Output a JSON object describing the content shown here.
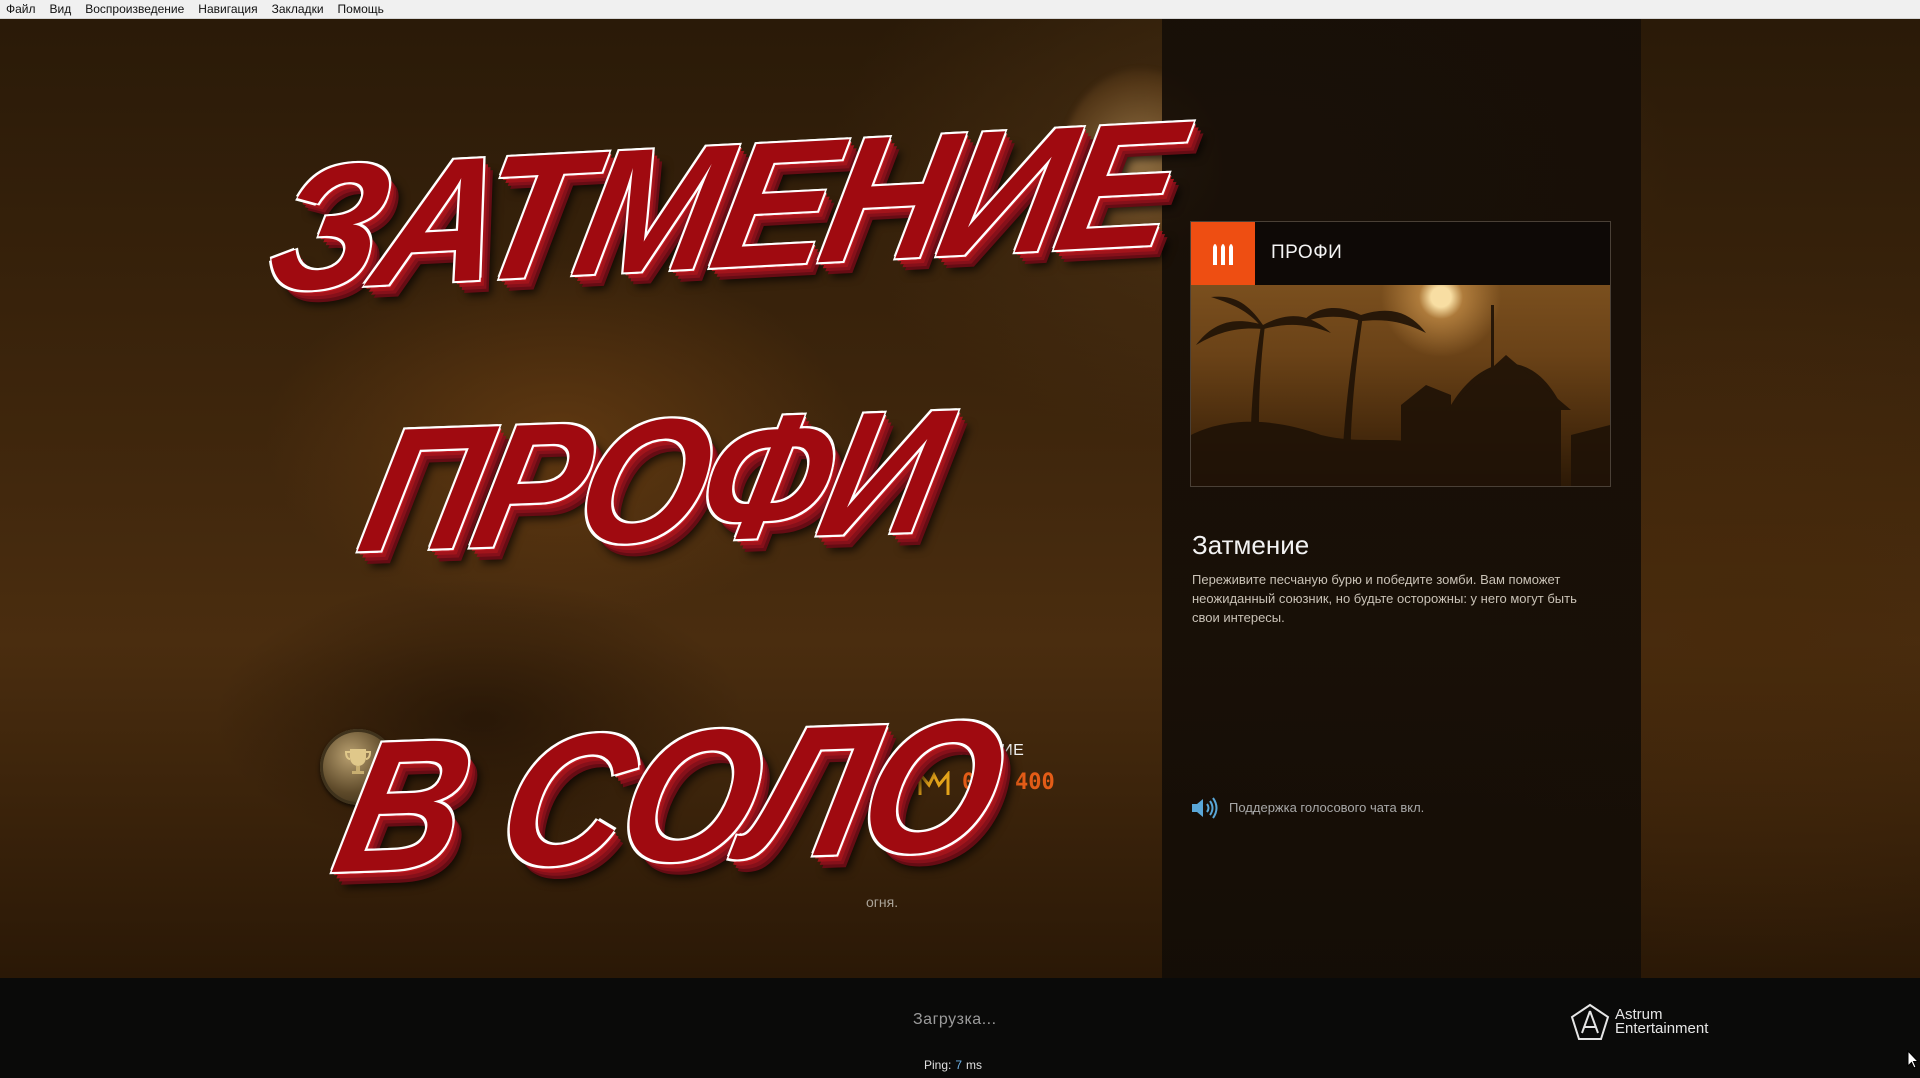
{
  "menu": [
    "Файл",
    "Вид",
    "Воспроизведение",
    "Навигация",
    "Закладки",
    "Помощь"
  ],
  "thumbnail": {
    "line1": "ЗАТМЕНИЕ",
    "line2": "ПРОФИ",
    "line3": "В СОЛО"
  },
  "challenge": {
    "label": "ИСПЫТАНИЕ",
    "progress": "0/2 400",
    "desc_tail": "огня."
  },
  "mode": {
    "label": "ПРОФИ",
    "badge_icon": "bullets-icon",
    "badge_color": "#ee4e12"
  },
  "mission": {
    "title": "Затмение",
    "description": "Переживите песчаную бурю и победите зомби. Вам поможет неожиданный союзник, но будьте осторожны: у него могут быть свои интересы."
  },
  "voice": {
    "label": "Поддержка голосового чата вкл.",
    "icon": "speaker-icon"
  },
  "loading": "Загрузка...",
  "ping": {
    "label": "Ping:",
    "value": "7",
    "unit": "ms"
  },
  "publisher": {
    "line1": "Astrum",
    "line2": "Entertainment"
  },
  "colors": {
    "accent": "#ee4e12",
    "progress": "#e35c17",
    "ping_value": "#6fb3e8",
    "thumbnail_red": "#a00a10"
  }
}
